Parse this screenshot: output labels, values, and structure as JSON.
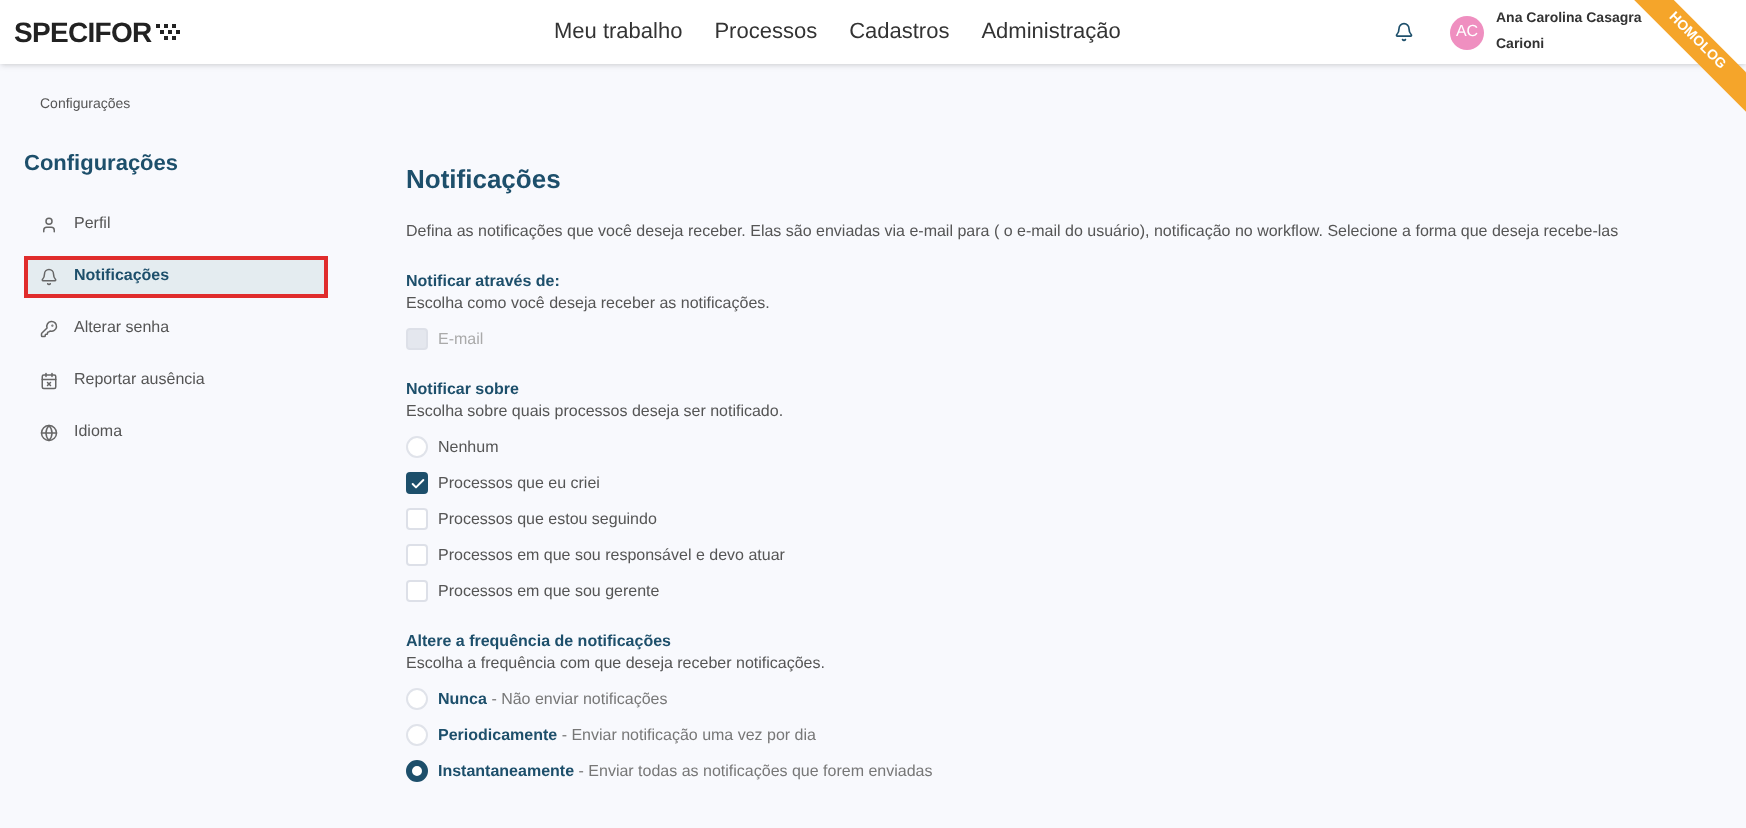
{
  "header": {
    "logo": "SPECIFOR",
    "nav": [
      "Meu trabalho",
      "Processos",
      "Cadastros",
      "Administração"
    ],
    "user": {
      "initials": "AC",
      "name_line_1": "Ana Carolina Casagra",
      "name_line_2": "Carioni"
    },
    "ribbon": "HOMOLOG"
  },
  "breadcrumb": "Configurações",
  "sidebar": {
    "title": "Configurações",
    "items": [
      {
        "label": "Perfil",
        "selected": false
      },
      {
        "label": "Notificações",
        "selected": true
      },
      {
        "label": "Alterar senha",
        "selected": false
      },
      {
        "label": "Reportar ausência",
        "selected": false
      },
      {
        "label": "Idioma",
        "selected": false
      }
    ]
  },
  "content": {
    "title": "Notificações",
    "description": "Defina as notificações que você deseja receber. Elas são enviadas via e-mail para ( o e-mail do usuário), notificação no workflow. Selecione a forma que deseja recebe-las",
    "sections": [
      {
        "title": "Notificar através de:",
        "subtitle": "Escolha como você deseja receber as notificações.",
        "options": [
          {
            "kind": "checkbox",
            "label": "E-mail",
            "checked": false,
            "disabled": true
          }
        ]
      },
      {
        "title": "Notificar sobre",
        "subtitle": "Escolha sobre quais processos deseja ser notificado.",
        "options": [
          {
            "kind": "radio",
            "label": "Nenhum",
            "checked": false
          },
          {
            "kind": "checkbox",
            "label": "Processos que eu criei",
            "checked": true
          },
          {
            "kind": "checkbox",
            "label": "Processos que estou seguindo",
            "checked": false
          },
          {
            "kind": "checkbox",
            "label": "Processos em que sou responsável e devo atuar",
            "checked": false
          },
          {
            "kind": "checkbox",
            "label": "Processos em que sou gerente",
            "checked": false
          }
        ]
      },
      {
        "title": "Altere a frequência de notificações",
        "subtitle": "Escolha a frequência com que deseja receber notificações.",
        "options": [
          {
            "kind": "radio",
            "label": "Nunca",
            "detail": "- Não enviar notificações",
            "checked": false
          },
          {
            "kind": "radio",
            "label": "Periodicamente",
            "detail": "- Enviar notificação uma vez por dia",
            "checked": false
          },
          {
            "kind": "radio",
            "label": "Instantaneamente",
            "detail": "- Enviar todas as notificações que forem enviadas",
            "checked": true
          }
        ]
      }
    ]
  }
}
